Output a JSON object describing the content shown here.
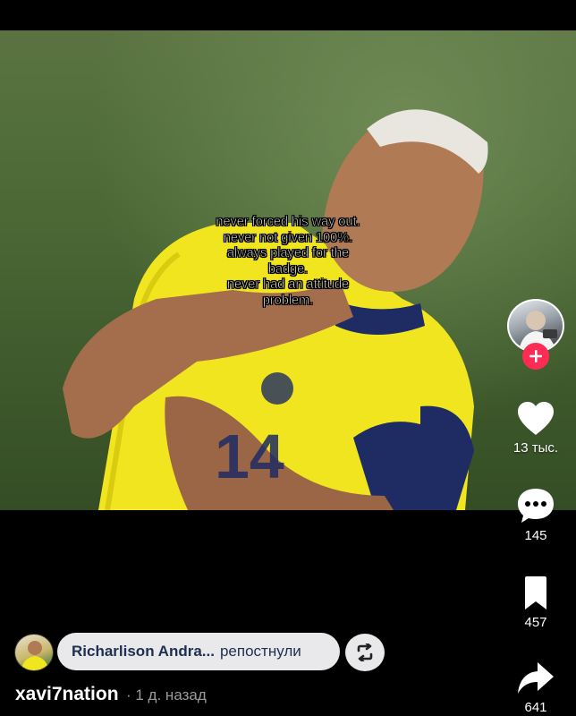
{
  "video": {
    "caption_lines": [
      "never forced his way out.",
      "never not given 100%.",
      "always played for the",
      "badge.",
      "never had an attitude",
      "problem."
    ]
  },
  "rail": {
    "follow_icon": "plus-icon",
    "like": {
      "icon": "heart-icon",
      "count": "13 тыс."
    },
    "comment": {
      "icon": "comment-bubble-icon",
      "count": "145"
    },
    "bookmark": {
      "icon": "bookmark-icon",
      "count": "457"
    },
    "share": {
      "icon": "share-arrow-icon",
      "count": "641"
    }
  },
  "repost": {
    "name": "Richarlison Andra...",
    "verb": "репостнули",
    "icon": "repost-icon"
  },
  "author": {
    "username": "xavi7nation",
    "time": "· 1 д. назад"
  },
  "colors": {
    "follow": "#fe2c55",
    "background": "#000000",
    "pill": "#e9e9ec"
  }
}
